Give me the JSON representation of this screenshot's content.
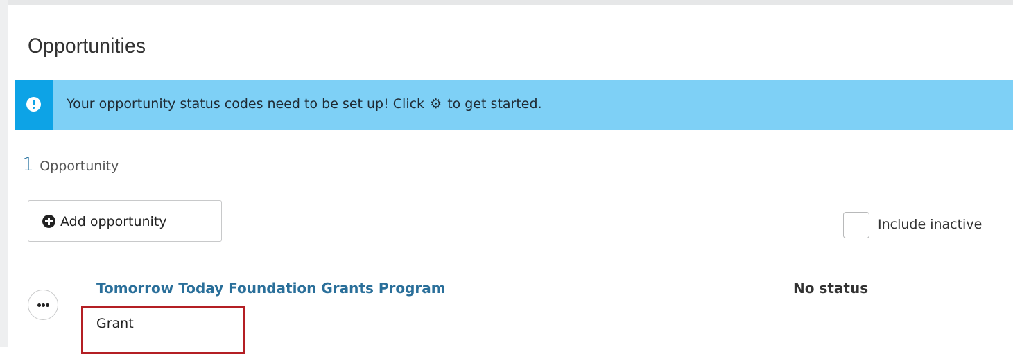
{
  "page": {
    "title": "Opportunities"
  },
  "banner": {
    "message_before": "Your opportunity status codes need to be set up!  Click",
    "message_after": "to get started.",
    "icon": "info-icon",
    "inline_icon": "gear-icon",
    "colors": {
      "background": "#7ed0f6",
      "accent_strip": "#0da3e6"
    }
  },
  "summary": {
    "count": "1",
    "label": "Opportunity"
  },
  "toolbar": {
    "add_label": "Add opportunity",
    "add_icon": "plus-circle-icon",
    "include_inactive_label": "Include inactive",
    "include_inactive_checked": false
  },
  "opportunities": [
    {
      "name": "Tomorrow Today Foundation Grants Program",
      "type": "Grant",
      "status": "No status",
      "menu_icon": "ellipsis-icon"
    }
  ],
  "colors": {
    "link": "#2a6f9a",
    "highlight": "#b41f24"
  }
}
